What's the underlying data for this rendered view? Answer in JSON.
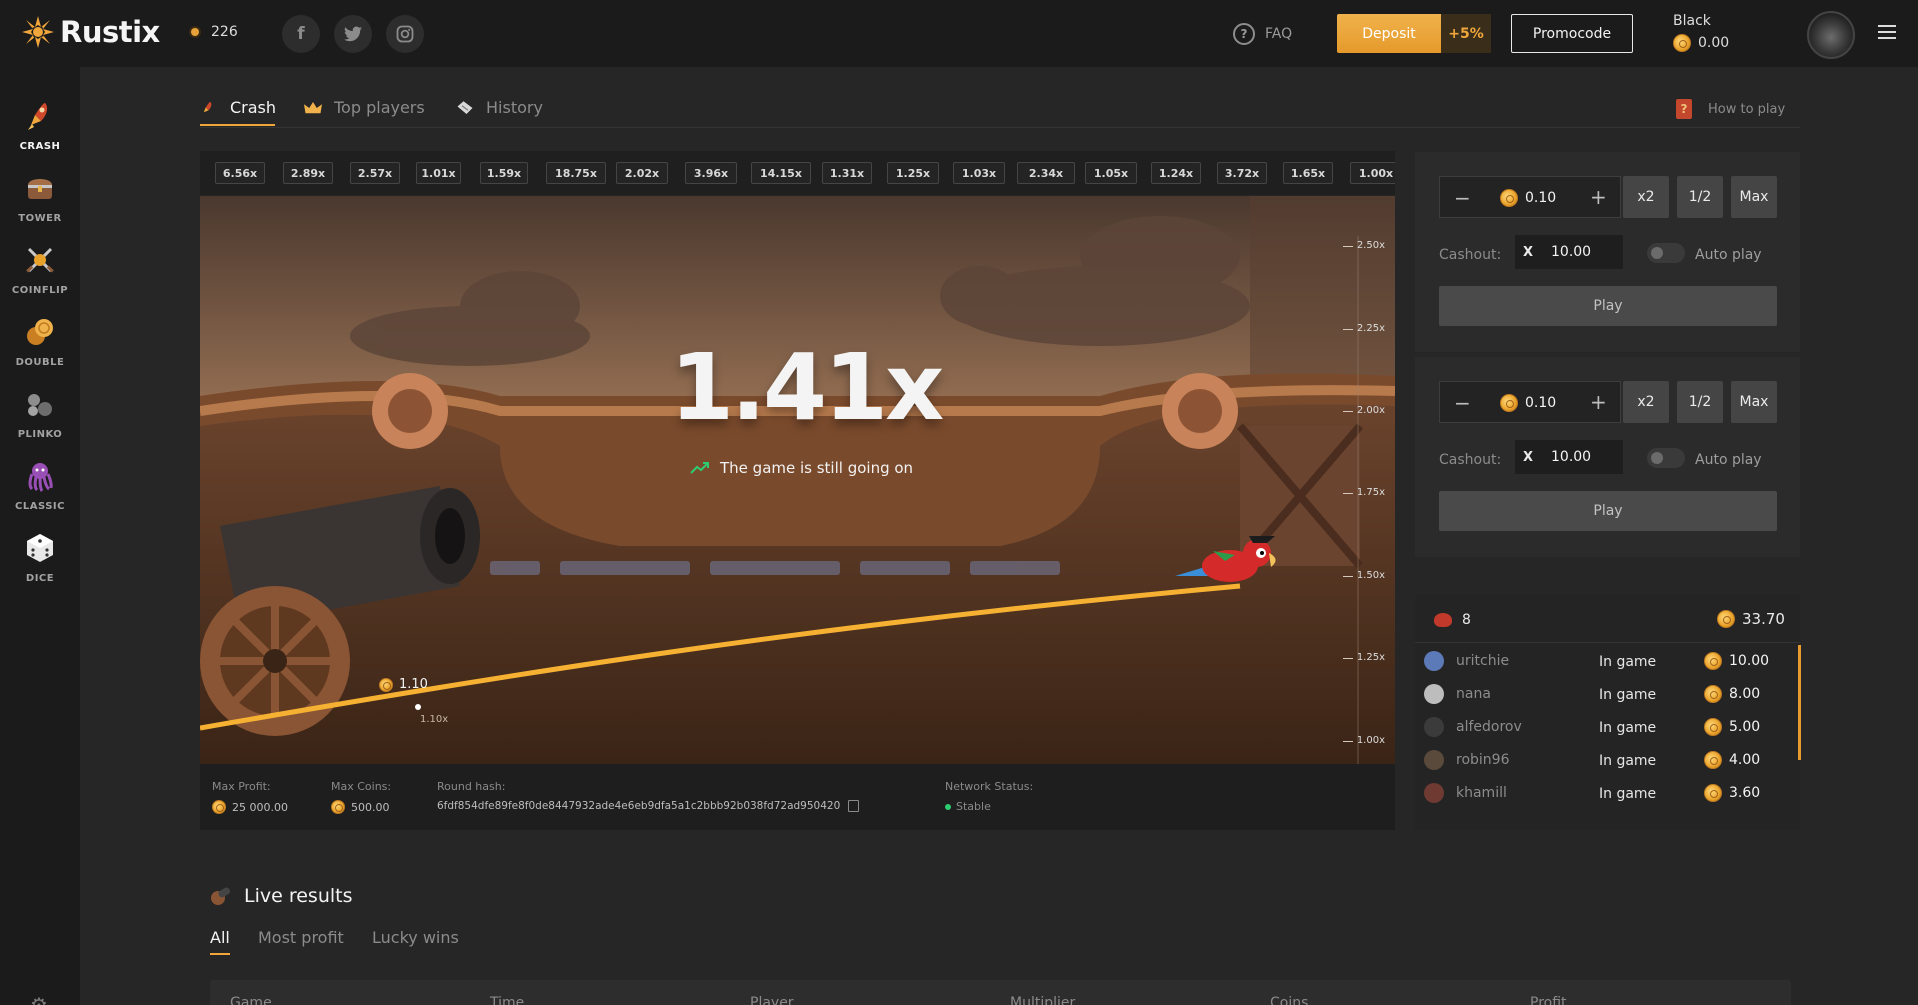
{
  "header": {
    "brand": "Rustix",
    "online_count": "226",
    "social": [
      "f",
      "t",
      "ig"
    ],
    "faq_label": "FAQ",
    "deposit_label": "Deposit",
    "deposit_bonus": "+5%",
    "promocode_label": "Promocode",
    "user_name": "Black",
    "user_balance": "0.00"
  },
  "sidebar": {
    "items": [
      {
        "label": "CRASH",
        "icon": "crash-rocket-icon",
        "active": true
      },
      {
        "label": "TOWER",
        "icon": "tower-chest-icon"
      },
      {
        "label": "COINFLIP",
        "icon": "coinflip-swords-icon"
      },
      {
        "label": "DOUBLE",
        "icon": "double-coins-icon"
      },
      {
        "label": "PLINKO",
        "icon": "plinko-balls-icon"
      },
      {
        "label": "CLASSIC",
        "icon": "classic-octopus-icon"
      },
      {
        "label": "DICE",
        "icon": "dice-icon"
      }
    ]
  },
  "game_tabs": {
    "crash": "Crash",
    "top_players": "Top players",
    "history": "History",
    "how_to_play": "How to play"
  },
  "multipliers": [
    "6.56x",
    "2.89x",
    "2.57x",
    "1.01x",
    "1.59x",
    "18.75x",
    "2.02x",
    "3.96x",
    "14.15x",
    "1.31x",
    "1.25x",
    "1.03x",
    "2.34x",
    "1.05x",
    "1.24x",
    "3.72x",
    "1.65x",
    "1.00x"
  ],
  "game": {
    "current_multiplier": "1.41x",
    "status": "The game is still going on",
    "bet_marker_amount": "1.10",
    "bet_marker_mult": "1.10x",
    "y_axis": [
      "2.50x",
      "2.25x",
      "2.00x",
      "1.75x",
      "1.50x",
      "1.25x",
      "1.00x"
    ]
  },
  "game_footer": {
    "max_profit_label": "Max Profit:",
    "max_profit_value": "25 000.00",
    "max_coins_label": "Max Coins:",
    "max_coins_value": "500.00",
    "round_hash_label": "Round hash:",
    "round_hash_value": "6fdf854dfe89fe8f0de8447932ade4e6eb9dfa5a1c2bbb92b038fd72ad950420",
    "network_label": "Network Status:",
    "network_value": "Stable"
  },
  "bet_panels": [
    {
      "amount": "0.10",
      "x2": "x2",
      "half": "1/2",
      "max": "Max",
      "cashout_label": "Cashout:",
      "cashout_x": "X",
      "cashout_value": "10.00",
      "auto_label": "Auto play",
      "play_label": "Play"
    },
    {
      "amount": "0.10",
      "x2": "x2",
      "half": "1/2",
      "max": "Max",
      "cashout_label": "Cashout:",
      "cashout_x": "X",
      "cashout_value": "10.00",
      "auto_label": "Auto play",
      "play_label": "Play"
    }
  ],
  "players": {
    "count": "8",
    "total": "33.70",
    "rows": [
      {
        "name": "uritchie",
        "status": "In game",
        "bet": "10.00"
      },
      {
        "name": "nana",
        "status": "In game",
        "bet": "8.00"
      },
      {
        "name": "alfedorov",
        "status": "In game",
        "bet": "5.00"
      },
      {
        "name": "robin96",
        "status": "In game",
        "bet": "4.00"
      },
      {
        "name": "khamill",
        "status": "In game",
        "bet": "3.60"
      }
    ]
  },
  "live_results": {
    "title": "Live results",
    "tabs": [
      "All",
      "Most profit",
      "Lucky wins"
    ],
    "columns": [
      "Game",
      "Time",
      "Player",
      "Multiplier",
      "Coins",
      "Profit"
    ]
  },
  "colors": {
    "accent": "#f0a63a",
    "background": "#222222",
    "panel": "#2b2b2b"
  }
}
